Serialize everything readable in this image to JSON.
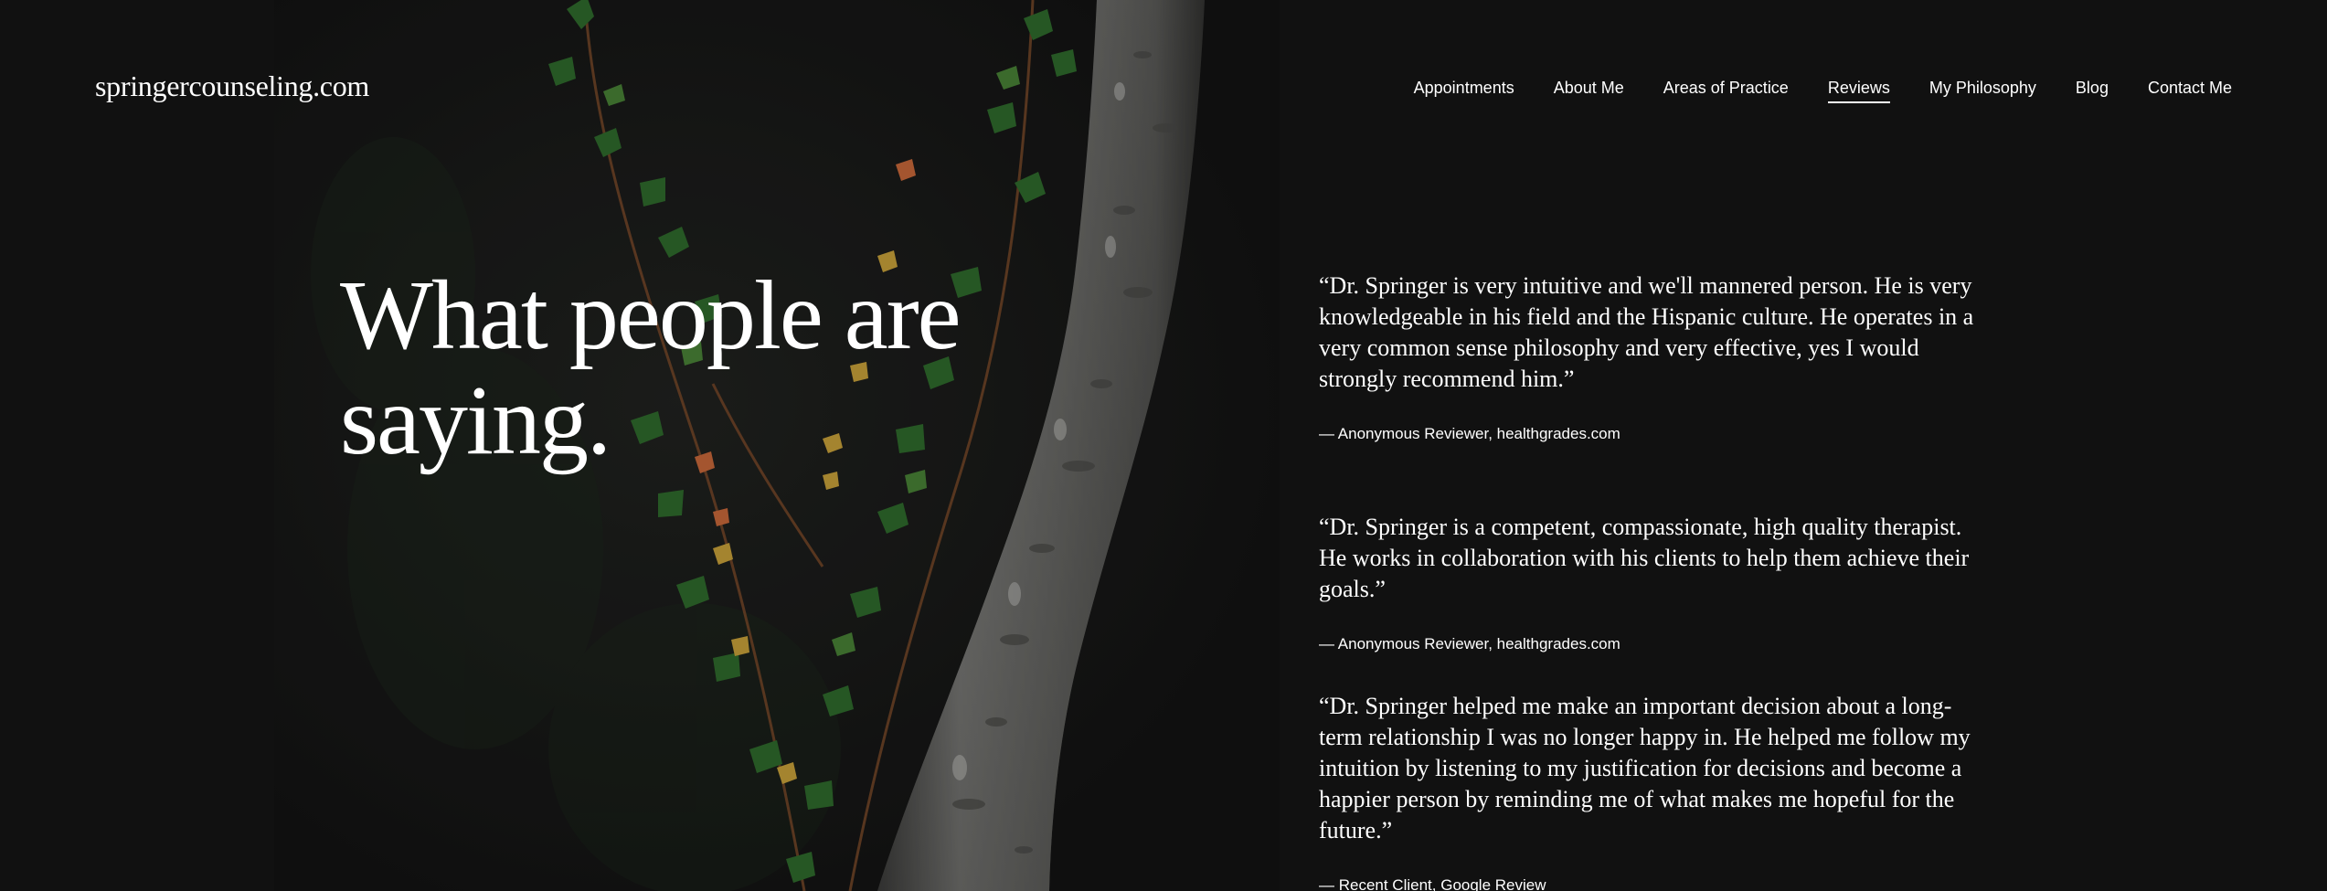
{
  "header": {
    "site_title": "springercounseling.com",
    "nav": [
      {
        "label": "Appointments",
        "active": false
      },
      {
        "label": "About Me",
        "active": false
      },
      {
        "label": "Areas of Practice",
        "active": false
      },
      {
        "label": "Reviews",
        "active": true
      },
      {
        "label": "My Philosophy",
        "active": false
      },
      {
        "label": "Blog",
        "active": false
      },
      {
        "label": "Contact Me",
        "active": false
      }
    ]
  },
  "hero": {
    "headline_line1": "What people are",
    "headline_line2": "saying."
  },
  "reviews": [
    {
      "quote": "“Dr. Springer is very intuitive and we'll mannered person. He is very knowledgeable in his field and the Hispanic culture. He operates in a very common sense philosophy and very effective, yes I would strongly recommend him.”",
      "attribution": "— Anonymous Reviewer, healthgrades.com"
    },
    {
      "quote": "“Dr. Springer is a competent, compassionate, high quality therapist. He works in collaboration with his clients to help them achieve their goals.”",
      "attribution": "— Anonymous Reviewer, healthgrades.com"
    },
    {
      "quote": "“Dr. Springer helped me make an important decision about a long-term relationship I was no longer happy in. He helped me follow my intuition by listening to my justification for decisions and become a happier person by reminding me of what makes me hopeful for the future.”",
      "attribution": "— Recent Client, Google Review"
    }
  ],
  "colors": {
    "background": "#151515",
    "text": "#ffffff",
    "bark": "#8f8f8f",
    "leaf_green": "#2f6b2c",
    "leaf_yellow": "#c9a13a",
    "leaf_orange": "#c8683a"
  },
  "background_image": "tree-trunk-with-ivy"
}
